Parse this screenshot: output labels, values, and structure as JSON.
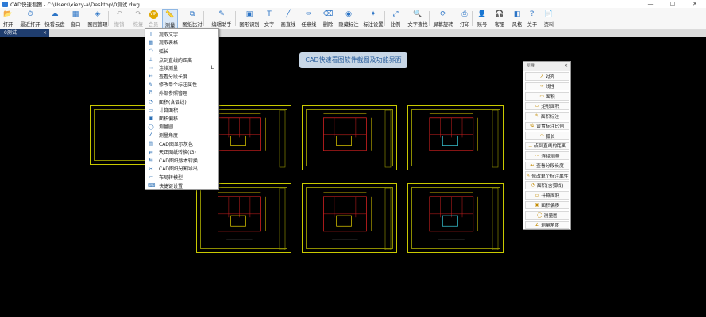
{
  "window": {
    "title": "CAD快速看图 - C:\\Users\\xiezy-a\\Desktop\\0测试.dwg",
    "controls": [
      "—",
      "☐",
      "✕"
    ]
  },
  "toolbar": {
    "items": [
      {
        "label": "打开",
        "icon": "folder-icon",
        "glyph": "📂",
        "disabled": false
      },
      {
        "label": "最近打开",
        "icon": "clock-icon",
        "glyph": "⏱",
        "disabled": false
      },
      {
        "label": "快看云盘",
        "icon": "cloud-icon",
        "glyph": "☁",
        "disabled": false
      },
      {
        "label": "窗口",
        "icon": "window-icon",
        "glyph": "▦",
        "disabled": false
      },
      {
        "label": "图层管理",
        "icon": "layers-icon",
        "glyph": "◈",
        "disabled": false
      },
      {
        "label": "撤销",
        "icon": "undo-icon",
        "glyph": "↶",
        "disabled": true
      },
      {
        "label": "恢复",
        "icon": "redo-icon",
        "glyph": "↷",
        "disabled": true
      },
      {
        "label": "会员",
        "icon": "vip-icon",
        "glyph": "VIP",
        "disabled": true
      },
      {
        "label": "测量",
        "icon": "ruler-icon",
        "glyph": "📏",
        "disabled": false
      },
      {
        "label": "图纸比对",
        "icon": "compare-icon",
        "glyph": "⧉",
        "disabled": false
      },
      {
        "label": "编辑助手",
        "icon": "edit-assistant-icon",
        "glyph": "✎",
        "disabled": false
      },
      {
        "label": "图形识别",
        "icon": "shape-recognition-icon",
        "glyph": "▣",
        "disabled": false
      },
      {
        "label": "文字",
        "icon": "text-icon",
        "glyph": "T",
        "disabled": false
      },
      {
        "label": "画直线",
        "icon": "line-icon",
        "glyph": "╱",
        "disabled": false
      },
      {
        "label": "任意线",
        "icon": "freeline-icon",
        "glyph": "✏",
        "disabled": false
      },
      {
        "label": "删除",
        "icon": "erase-icon",
        "glyph": "⌫",
        "disabled": false
      },
      {
        "label": "隐藏标注",
        "icon": "eye-icon",
        "glyph": "◉",
        "disabled": false
      },
      {
        "label": "标注设置",
        "icon": "annotation-settings-icon",
        "glyph": "✦",
        "disabled": false
      },
      {
        "label": "比例",
        "icon": "scale-icon",
        "glyph": "⤢",
        "disabled": false
      },
      {
        "label": "文字查找",
        "icon": "text-search-icon",
        "glyph": "🔍",
        "disabled": false
      },
      {
        "label": "屏幕旋转",
        "icon": "rotate-screen-icon",
        "glyph": "⟳",
        "disabled": false
      },
      {
        "label": "打印",
        "icon": "print-icon",
        "glyph": "⎙",
        "disabled": false
      },
      {
        "label": "账号",
        "icon": "user-icon",
        "glyph": "👤",
        "disabled": false
      },
      {
        "label": "客服",
        "icon": "headset-icon",
        "glyph": "🎧",
        "disabled": false
      },
      {
        "label": "风格",
        "icon": "style-icon",
        "glyph": "◧",
        "disabled": false
      },
      {
        "label": "关于",
        "icon": "help-icon",
        "glyph": "?",
        "disabled": false
      },
      {
        "label": "资料",
        "icon": "document-icon",
        "glyph": "📄",
        "disabled": false
      }
    ]
  },
  "tabs": [
    {
      "label": "0测试",
      "close": "×"
    }
  ],
  "measure_menu": {
    "items": [
      {
        "label": "提取文字",
        "icon": "extract-text-icon",
        "glyph": "T",
        "shortcut": ""
      },
      {
        "label": "提取表格",
        "icon": "extract-table-icon",
        "glyph": "▦",
        "shortcut": ""
      },
      {
        "label": "弧长",
        "icon": "arc-length-icon",
        "glyph": "◠",
        "shortcut": ""
      },
      {
        "label": "点到直线的距离",
        "icon": "point-line-distance-icon",
        "glyph": "⊥",
        "shortcut": ""
      },
      {
        "label": "连续测量",
        "icon": "continuous-measure-icon",
        "glyph": "⋯",
        "shortcut": "L"
      },
      {
        "label": "查看分段长度",
        "icon": "segment-length-icon",
        "glyph": "↔",
        "shortcut": ""
      },
      {
        "label": "修改单个标注属性",
        "icon": "annotation-property-icon",
        "glyph": "✎",
        "shortcut": ""
      },
      {
        "label": "外部参照管理",
        "icon": "xref-icon",
        "glyph": "⧉",
        "shortcut": ""
      },
      {
        "label": "面积(含弧线)",
        "icon": "area-arc-icon",
        "glyph": "◔",
        "shortcut": ""
      },
      {
        "label": "计算面积",
        "icon": "calc-area-icon",
        "glyph": "▭",
        "shortcut": ""
      },
      {
        "label": "面积偏移",
        "icon": "area-offset-icon",
        "glyph": "▣",
        "shortcut": ""
      },
      {
        "label": "测量圆",
        "icon": "measure-circle-icon",
        "glyph": "◯",
        "shortcut": ""
      },
      {
        "label": "测量角度",
        "icon": "measure-angle-icon",
        "glyph": "∠",
        "shortcut": ""
      },
      {
        "label": "CAD图显示灰色",
        "icon": "gray-display-icon",
        "glyph": "▤",
        "shortcut": ""
      },
      {
        "label": "天正图纸转换(t3)",
        "icon": "convert-t3-icon",
        "glyph": "⇄",
        "shortcut": ""
      },
      {
        "label": "CAD图纸版本转换",
        "icon": "version-convert-icon",
        "glyph": "⇆",
        "shortcut": ""
      },
      {
        "label": "CAD图纸分割导出",
        "icon": "split-export-icon",
        "glyph": "✂",
        "shortcut": ""
      },
      {
        "label": "布局转模型",
        "icon": "layout-to-model-icon",
        "glyph": "▱",
        "shortcut": ""
      },
      {
        "label": "快捷键设置",
        "icon": "hotkey-settings-icon",
        "glyph": "⌨",
        "shortcut": ""
      }
    ]
  },
  "banner": {
    "text": "CAD快速看图软件截图及功能界面"
  },
  "measure_panel": {
    "title": "测量",
    "close": "×",
    "items": [
      {
        "label": "对齐",
        "icon": "align-icon",
        "glyph": "↗"
      },
      {
        "label": "线性",
        "icon": "linear-icon",
        "glyph": "↔"
      },
      {
        "label": "面积",
        "icon": "area-icon",
        "glyph": "▭"
      },
      {
        "label": "矩形面积",
        "icon": "rect-area-icon",
        "glyph": "▭"
      },
      {
        "label": "面积标注",
        "icon": "area-annotation-icon",
        "glyph": "✎"
      },
      {
        "label": "设置标注比例",
        "icon": "annotation-scale-icon",
        "glyph": "⚙"
      },
      {
        "label": "弧长",
        "icon": "arc-length-icon",
        "glyph": "◠"
      },
      {
        "label": "点到直线的距离",
        "icon": "point-line-distance-icon",
        "glyph": "⊥"
      },
      {
        "label": "连续测量",
        "icon": "continuous-measure-icon",
        "glyph": "⋯"
      },
      {
        "label": "查看分段长度",
        "icon": "segment-length-icon",
        "glyph": "↔"
      },
      {
        "label": "修改单个标注属性",
        "icon": "annotation-property-icon",
        "glyph": "✎"
      },
      {
        "label": "面积(含弧线)",
        "icon": "area-arc-icon",
        "glyph": "◔"
      },
      {
        "label": "计算面积",
        "icon": "calc-area-icon",
        "glyph": "▭"
      },
      {
        "label": "面积偏移",
        "icon": "area-offset-icon",
        "glyph": "▣"
      },
      {
        "label": "测量圆",
        "icon": "measure-circle-icon",
        "glyph": "◯"
      },
      {
        "label": "测量角度",
        "icon": "measure-angle-icon",
        "glyph": "∠"
      }
    ]
  },
  "colors": {
    "accent": "#2b74c6",
    "sheet_border": "#c9c900",
    "plan_red": "#d02020",
    "plan_cyan": "#3ad0e0",
    "plan_yellow": "#e6d200"
  }
}
